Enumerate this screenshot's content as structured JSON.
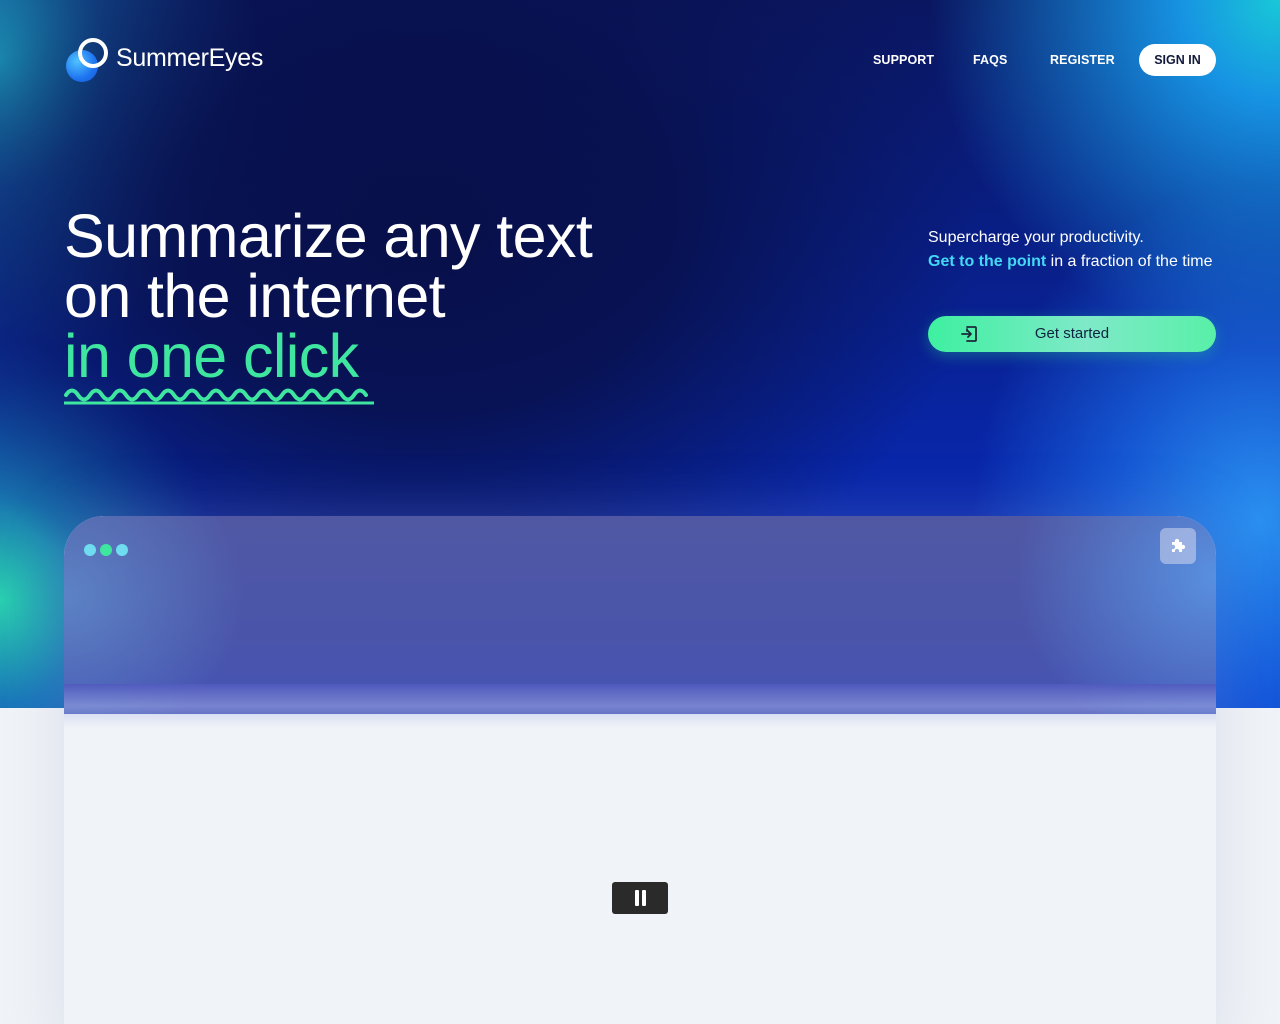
{
  "header": {
    "brand": "SummerEyes",
    "nav": [
      "SUPPORT",
      "FAQS",
      "REGISTER"
    ],
    "sign_in": "SIGN IN"
  },
  "hero": {
    "headline_line1": "Summarize any text",
    "headline_line2": "on the internet",
    "headline_line3": "in one click",
    "tagline_line1": "Supercharge your productivity.",
    "tagline_highlight": "Get to the point",
    "tagline_rest": " in a fraction of the time",
    "cta_label": "Get started"
  },
  "colors": {
    "accent_green": "#3ee6a0",
    "accent_cyan": "#43d9f5",
    "hero_dark": "#08104a",
    "hero_blue": "#0826a8"
  },
  "mockup": {
    "window_dots": [
      "#6fdcf0",
      "#3ee6a0",
      "#6fdcf0"
    ],
    "extension_icon": "puzzle-icon",
    "video_control_icon": "pause-icon"
  }
}
